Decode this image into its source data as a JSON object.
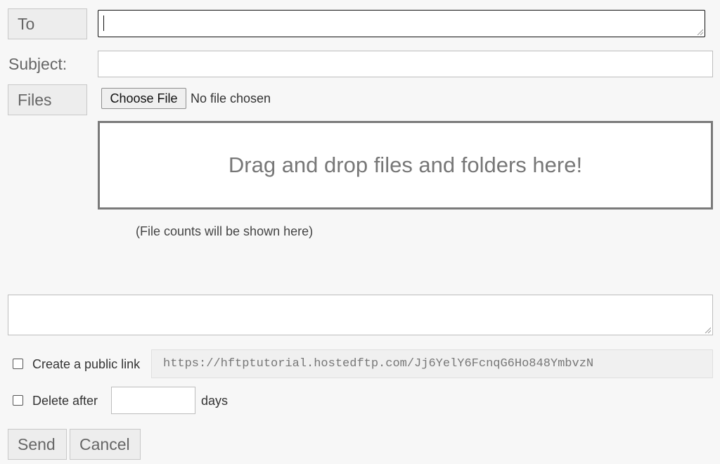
{
  "form": {
    "to_button": "To",
    "to_value": "",
    "subject_label": "Subject:",
    "subject_value": "",
    "files_button": "Files",
    "choose_file_button": "Choose File",
    "no_file_text": "No file chosen",
    "dropzone_text": "Drag and drop files and folders here!",
    "file_counts_text": "(File counts will be shown here)",
    "message_value": ""
  },
  "options": {
    "public_link_label": "Create a public link",
    "public_link_checked": false,
    "public_link_url": "https://hftptutorial.hostedftp.com/Jj6YelY6FcnqG6Ho848YmbvzN",
    "delete_after_label": "Delete after",
    "delete_after_checked": false,
    "delete_after_days_value": "",
    "days_unit": "days"
  },
  "actions": {
    "send_label": "Send",
    "cancel_label": "Cancel"
  }
}
